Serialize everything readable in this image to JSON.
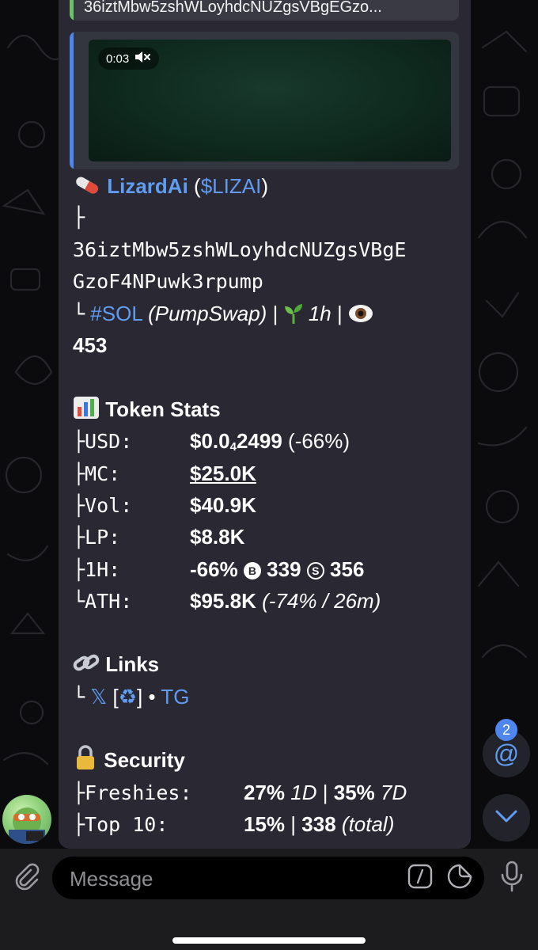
{
  "reply": {
    "text": "36iztMbw5zshWLoyhdcNUZgsVBgEGzo..."
  },
  "video": {
    "time": "0:03",
    "mute_icon": "speaker-muted-icon"
  },
  "message": {
    "title_emoji": "pill-icon",
    "token_name": "LizardAi",
    "ticker": "($LIZAI)",
    "tree_branch": "├",
    "address_line1": "36iztMbw5zshWLoyhdcNUZgsVBgE",
    "address_line2": "GzoF4NPuwk3rpump",
    "tree_end": "└",
    "chain": "#SOL",
    "dex": "(PumpSwap)",
    "separator": "|",
    "age_emoji": "seedling-icon",
    "age": "1h",
    "views_emoji": "eye-icon",
    "views": "453",
    "stats": {
      "header": "Token Stats",
      "usd_label": "├USD:",
      "usd_value_prefix": "$0.0",
      "usd_value_sub": "4",
      "usd_value_rest": "2499",
      "usd_change": "(-66%)",
      "mc_label": "├MC:",
      "mc_value": "$25.0K",
      "vol_label": "├Vol:",
      "vol_value": "$40.9K",
      "lp_label": "├LP:",
      "lp_value": "$8.8K",
      "h1_label": "├1H:",
      "h1_change": "-66%",
      "buy_icon_letter": "B",
      "buys": "339",
      "sell_icon_letter": "S",
      "sells": "356",
      "ath_label": "└ATH:",
      "ath_value": "$95.8K",
      "ath_detail": "(-74% / 26m)"
    },
    "links": {
      "header": "Links",
      "tree": "└",
      "x_label": "𝕏",
      "bracket_open": "[",
      "recycle_label": "♻",
      "bracket_close": "]",
      "dot": "•",
      "tg_label": "TG"
    },
    "security": {
      "header": "Security",
      "freshies_label": "├Freshies:",
      "freshies_1d": "27%",
      "freshies_1d_unit": "1D",
      "freshies_7d": "35%",
      "freshies_7d_unit": "7D",
      "top10_label": "├Top 10:",
      "top10_pct": "15%",
      "top10_total": "338",
      "top10_total_label": "(total)"
    }
  },
  "mention_badge": "2",
  "composer": {
    "placeholder": "Message"
  },
  "colors": {
    "link": "#5f9cf2",
    "bubble": "#2a2933",
    "reply_accent": "#6cc26a",
    "media_accent": "#4f86ee"
  }
}
